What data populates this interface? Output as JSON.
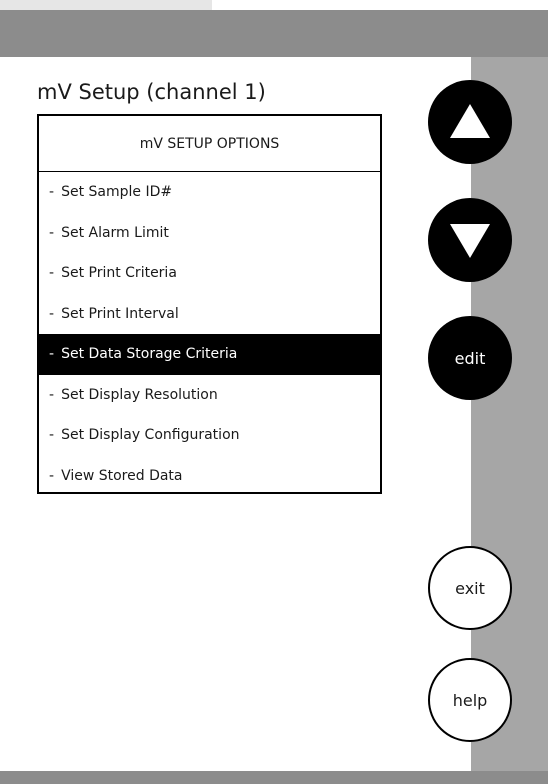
{
  "screen": {
    "title": "mV Setup (channel 1)"
  },
  "options": {
    "header": "mV SETUP OPTIONS",
    "bullet": "-",
    "items": [
      {
        "label": "Set Sample ID#"
      },
      {
        "label": "Set Alarm Limit"
      },
      {
        "label": "Set Print Criteria"
      },
      {
        "label": "Set Print Interval"
      },
      {
        "label": "Set Data Storage Criteria"
      },
      {
        "label": "Set Display Resolution"
      },
      {
        "label": "Set Display Configuration"
      },
      {
        "label": "View Stored Data"
      }
    ],
    "selected_index": 4
  },
  "buttons": {
    "up_icon": "triangle-up-icon",
    "down_icon": "triangle-down-icon",
    "edit": "edit",
    "exit": "exit",
    "help": "help"
  },
  "colors": {
    "frame_gray": "#8c8c8c",
    "panel_gray": "#a6a6a6",
    "button_black": "#000000",
    "highlight_bg": "#000000",
    "highlight_text": "#ffffff"
  }
}
